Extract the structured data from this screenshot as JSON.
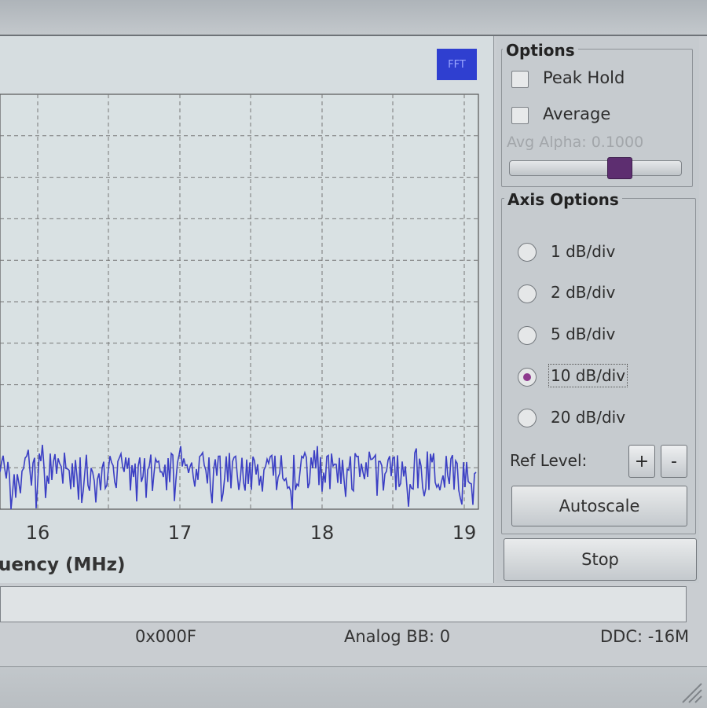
{
  "plot": {
    "badge": "FFT",
    "x_ticks": [
      "16",
      "17",
      "18",
      "19"
    ],
    "x_label": "uency (MHz)",
    "trace_color": "#3b3fc4"
  },
  "options": {
    "title": "Options",
    "peak_hold": "Peak Hold",
    "average": "Average",
    "avg_alpha": "Avg Alpha: 0.1000",
    "avg_alpha_value": 0.1
  },
  "axis": {
    "title": "Axis Options",
    "items": [
      {
        "label": "1 dB/div",
        "selected": false
      },
      {
        "label": "2 dB/div",
        "selected": false
      },
      {
        "label": "5 dB/div",
        "selected": false
      },
      {
        "label": "10 dB/div",
        "selected": true
      },
      {
        "label": "20 dB/div",
        "selected": false
      }
    ],
    "ref_level": "Ref Level:",
    "plus": "+",
    "minus": "-",
    "autoscale": "Autoscale"
  },
  "stop": "Stop",
  "status": {
    "code": "0x000F",
    "analog": "Analog BB: 0",
    "ddc": "DDC: -16M"
  }
}
